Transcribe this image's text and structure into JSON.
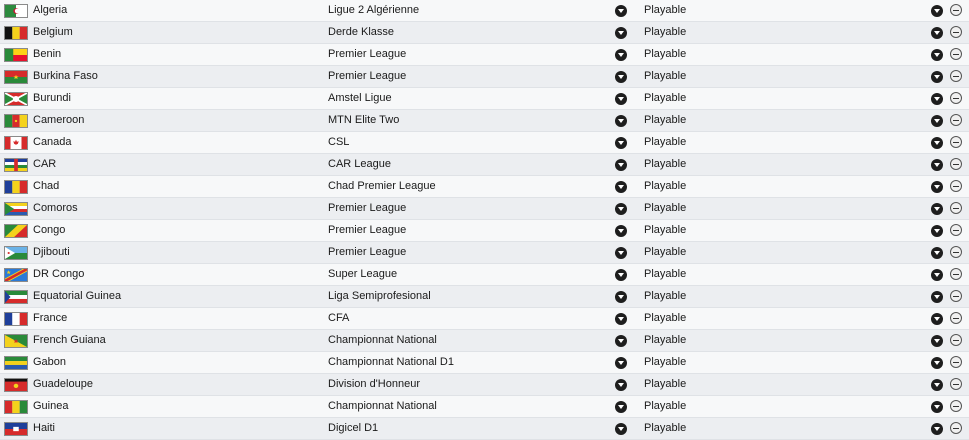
{
  "rows": [
    {
      "nation": "Algeria",
      "league": "Ligue 2 Algérienne",
      "status": "Playable",
      "flag": "algeria"
    },
    {
      "nation": "Belgium",
      "league": "Derde Klasse",
      "status": "Playable",
      "flag": "belgium"
    },
    {
      "nation": "Benin",
      "league": "Premier League",
      "status": "Playable",
      "flag": "benin"
    },
    {
      "nation": "Burkina Faso",
      "league": "Premier League",
      "status": "Playable",
      "flag": "burkina-faso"
    },
    {
      "nation": "Burundi",
      "league": "Amstel Ligue",
      "status": "Playable",
      "flag": "burundi"
    },
    {
      "nation": "Cameroon",
      "league": "MTN Elite Two",
      "status": "Playable",
      "flag": "cameroon"
    },
    {
      "nation": "Canada",
      "league": "CSL",
      "status": "Playable",
      "flag": "canada"
    },
    {
      "nation": "CAR",
      "league": "CAR League",
      "status": "Playable",
      "flag": "car"
    },
    {
      "nation": "Chad",
      "league": "Chad Premier League",
      "status": "Playable",
      "flag": "chad"
    },
    {
      "nation": "Comoros",
      "league": "Premier League",
      "status": "Playable",
      "flag": "comoros"
    },
    {
      "nation": "Congo",
      "league": "Premier League",
      "status": "Playable",
      "flag": "congo"
    },
    {
      "nation": "Djibouti",
      "league": "Premier League",
      "status": "Playable",
      "flag": "djibouti"
    },
    {
      "nation": "DR Congo",
      "league": "Super League",
      "status": "Playable",
      "flag": "dr-congo"
    },
    {
      "nation": "Equatorial Guinea",
      "league": "Liga Semiprofesional",
      "status": "Playable",
      "flag": "equatorial-guinea"
    },
    {
      "nation": "France",
      "league": "CFA",
      "status": "Playable",
      "flag": "france"
    },
    {
      "nation": "French Guiana",
      "league": "Championnat National",
      "status": "Playable",
      "flag": "french-guiana"
    },
    {
      "nation": "Gabon",
      "league": "Championnat National D1",
      "status": "Playable",
      "flag": "gabon"
    },
    {
      "nation": "Guadeloupe",
      "league": "Division d'Honneur",
      "status": "Playable",
      "flag": "guadeloupe"
    },
    {
      "nation": "Guinea",
      "league": "Championnat National",
      "status": "Playable",
      "flag": "guinea"
    },
    {
      "nation": "Haiti",
      "league": "Digicel D1",
      "status": "Playable",
      "flag": "haiti"
    }
  ]
}
